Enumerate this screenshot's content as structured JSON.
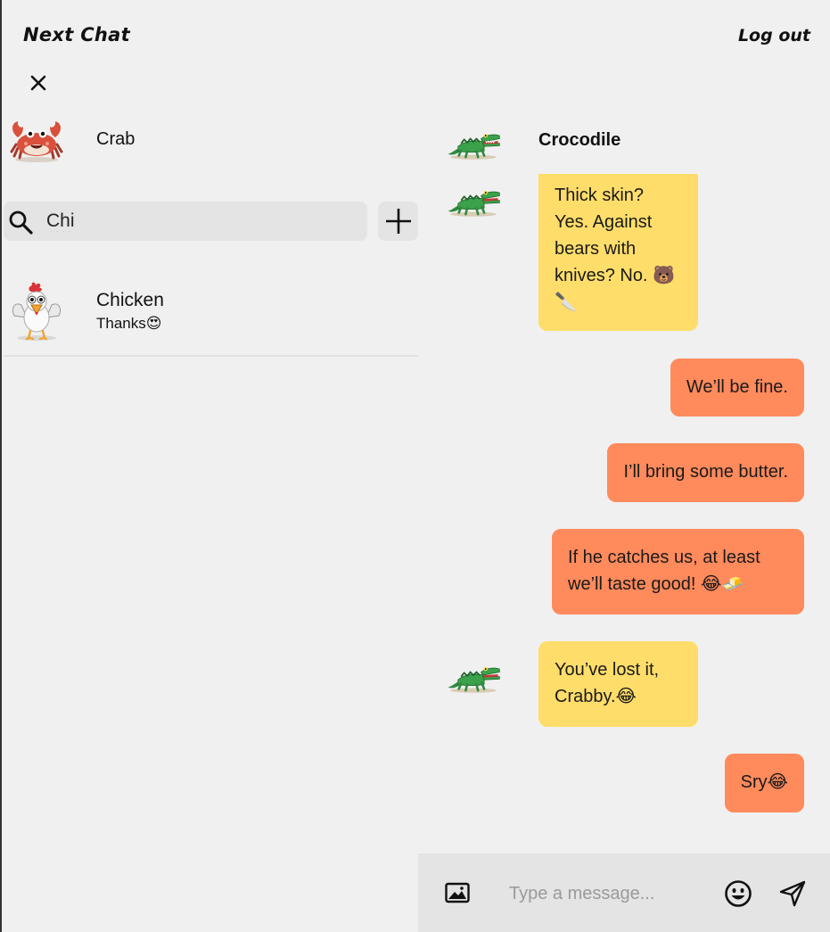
{
  "header": {
    "app_title": "Next Chat",
    "logout_label": "Log out"
  },
  "sidebar": {
    "current_user": {
      "name": "Crab",
      "avatar": "crab-avatar"
    },
    "search": {
      "value": "Chi",
      "placeholder": ""
    },
    "contacts": [
      {
        "name": "Chicken",
        "last_message": "Thanks😍",
        "avatar": "chicken-avatar"
      }
    ]
  },
  "chat": {
    "contact_name": "Crocodile",
    "messages": [
      {
        "from": "Crocodile",
        "direction": "incoming",
        "text": "Thick skin? Yes. Against bears with knives? No. 🐻🔪"
      },
      {
        "from": "Crab",
        "direction": "outgoing",
        "text": "We’ll be fine."
      },
      {
        "from": "Crab",
        "direction": "outgoing",
        "text": "I’ll bring some butter."
      },
      {
        "from": "Crab",
        "direction": "outgoing",
        "text": "If he catches us, at least we’ll taste good! 😂🧈"
      },
      {
        "from": "Crocodile",
        "direction": "incoming",
        "text": "You’ve lost it, Crabby.😂"
      },
      {
        "from": "Crab",
        "direction": "outgoing",
        "text": "Sry😂"
      }
    ],
    "composer": {
      "placeholder": "Type a message...",
      "value": ""
    }
  },
  "colors": {
    "background": "#f0f0f0",
    "incoming_bubble": "#ffdd6a",
    "outgoing_bubble": "#ff8a5c",
    "input_background": "#e4e4e4"
  },
  "icons": [
    "close-icon",
    "search-icon",
    "plus-icon",
    "image-icon",
    "emoji-icon",
    "send-icon"
  ]
}
